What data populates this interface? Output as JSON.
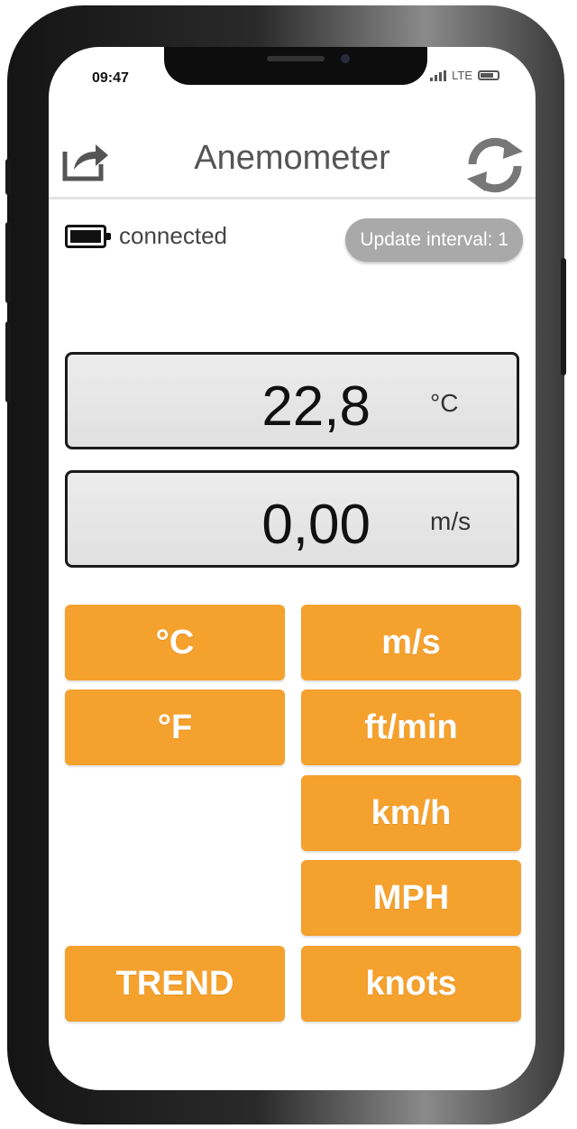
{
  "status_bar": {
    "time": "09:47",
    "network": "LTE"
  },
  "header": {
    "title": "Anemometer",
    "share_icon": "share-icon",
    "refresh_icon": "refresh-icon"
  },
  "connection": {
    "icon": "battery-icon",
    "status": "connected"
  },
  "update_interval": {
    "label": "Update interval: 1"
  },
  "readouts": {
    "temperature": {
      "value": "22,8",
      "unit": "°C"
    },
    "speed": {
      "value": "0,00",
      "unit": "m/s"
    }
  },
  "buttons": {
    "celsius": "°C",
    "fahrenheit": "°F",
    "trend": "TREND",
    "ms": "m/s",
    "ftmin": "ft/min",
    "kmh": "km/h",
    "mph": "MPH",
    "knots": "knots"
  },
  "colors": {
    "accent": "#f5a12e",
    "pill": "#a9a9a9"
  }
}
